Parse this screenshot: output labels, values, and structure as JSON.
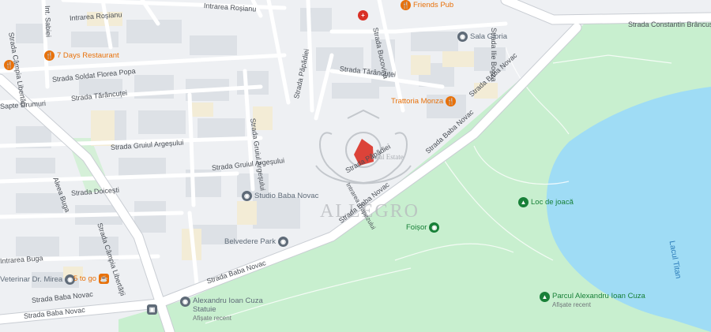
{
  "colors": {
    "background": "#eef0f3",
    "road": "#ffffff",
    "major_road": "#ffffff",
    "road_casing": "#c9cdd3",
    "building": "#dde1e6",
    "park": "#c8efcf",
    "water": "#9fdcf5",
    "poi_orange": "#e8710a",
    "poi_gray": "#5f6b78",
    "poi_green": "#188038",
    "poi_red": "#d93025",
    "highlight": "#d93025"
  },
  "streets": {
    "intrarea_rosianu": "Intrarea Roșianu",
    "intrarea_rosianu_2": "Intrarea Roșianu",
    "int_sabiei": "Int. Sabiei",
    "strada_campia_libertatii_n": "Strada Câmpia Libertății",
    "strada_campia_libertatii_s": "Strada Câmpia Libertății",
    "strada_soldat_florea_popa": "Strada Soldat Florea Popa",
    "strada_taruncutei_w": "Strada Tărâncuței",
    "strada_taruncutei_e": "Strada Tărâncuței",
    "sapte_drumuri": "Sapte Drumuri",
    "strada_bucovina": "Strada Bucovina",
    "strada_constantin_brancusi": "Strada Constantin Brâncuși",
    "strada_ilie_bogza": "Strada Ilie Bogza",
    "strada_papadiei": "Strada Păpădiei",
    "strada_papadiei_2": "Strada Păpădiei",
    "strada_gruiul_argesului_v": "Strada Gruiul Argeșului",
    "strada_gruiul_argesului_w": "Strada Gruiul Argeșului",
    "strada_gruiul_argesului_s": "Strada Gruiul Argeșului",
    "strada_dolcesti": "Strada Doicești",
    "aleea_buga": "Aleea Buga",
    "strada_buga": "Intrarea Buga",
    "strada_baba_novac_1": "Strada Baba Novac",
    "strada_baba_novac_2": "Strada Baba Novac",
    "strada_baba_novac_3": "Strada Baba Novac",
    "strada_baba_novac_4": "Strada Baba Novac",
    "strada_baba_novac_5": "Strada Baba Novac",
    "strada_baba_novac_6": "Strada Baba Novac",
    "strada_trapezului": "Intrarea Trapezului",
    "lacul_titan": "Lacul Titan"
  },
  "pois": [
    {
      "key": "friends_pub",
      "label": "Friends Pub",
      "icon": "restaurant-icon",
      "glyph": "🍴",
      "color": "#e8710a"
    },
    {
      "key": "seven_days",
      "label": "7 Days Restaurant",
      "icon": "restaurant-icon",
      "glyph": "🍴",
      "color": "#e8710a"
    },
    {
      "key": "sala_gloria",
      "label": "Sala Gloria",
      "icon": "place-icon",
      "glyph": "◉",
      "color": "#5f6b78"
    },
    {
      "key": "trattoria",
      "label": "Trattoria Monza",
      "icon": "restaurant-icon",
      "glyph": "🍴",
      "color": "#e8710a"
    },
    {
      "key": "studio",
      "label": "Studio Baba Novac",
      "icon": "place-icon",
      "glyph": "◉",
      "color": "#5f6b78"
    },
    {
      "key": "belvedere",
      "label": "Belvedere Park",
      "icon": "place-icon",
      "glyph": "◉",
      "color": "#5f6b78"
    },
    {
      "key": "loc_de_joaca",
      "label": "Loc de joacă",
      "icon": "park-icon",
      "glyph": "▲",
      "color": "#188038"
    },
    {
      "key": "foisor",
      "label": "Foișor",
      "icon": "park-icon",
      "glyph": "◉",
      "color": "#188038"
    },
    {
      "key": "parcul",
      "label": "Parcul Alexandru Ioan Cuza",
      "sub": "Afișate recent",
      "icon": "park-icon",
      "glyph": "▲",
      "color": "#188038"
    },
    {
      "key": "statuie",
      "label": "Alexandru Ioan Cuza Statuie",
      "sub": "Afișate recent",
      "icon": "place-icon",
      "glyph": "◉",
      "color": "#5f6b78"
    },
    {
      "key": "veterinar",
      "label": "Veterinar Dr. Mirea",
      "icon": "place-icon",
      "glyph": "◉",
      "color": "#5f6b78"
    },
    {
      "key": "five_to_go",
      "label": "5 to go",
      "icon": "cafe-icon",
      "glyph": "☕",
      "color": "#e8710a"
    },
    {
      "key": "hospital",
      "label": "",
      "icon": "hospital-icon",
      "glyph": "+",
      "color": "#d93025"
    }
  ],
  "watermark": {
    "brand": "ALLEGRO",
    "small": "Real Estate"
  }
}
